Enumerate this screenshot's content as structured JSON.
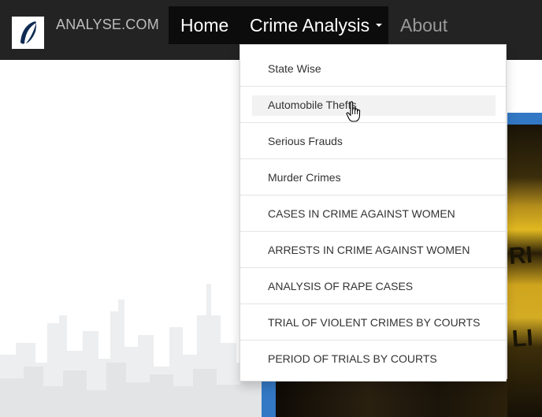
{
  "navbar": {
    "brand": "ANALYSE.COM",
    "logo_icon": "leaf-logo-icon",
    "items": [
      {
        "label": "Home"
      },
      {
        "label": "Crime Analysis"
      },
      {
        "label": "About"
      }
    ]
  },
  "dropdown": {
    "items": [
      {
        "label": "State Wise"
      },
      {
        "label": "Automobile Thefts"
      },
      {
        "label": "Serious Frauds"
      },
      {
        "label": "Murder Crimes"
      },
      {
        "label": "CASES IN CRIME AGAINST WOMEN"
      },
      {
        "label": "ARRESTS IN CRIME AGAINST WOMEN"
      },
      {
        "label": "ANALYSIS OF RAPE CASES"
      },
      {
        "label": "TRIAL OF VIOLENT CRIMES BY COURTS"
      },
      {
        "label": "PERIOD OF TRIALS BY COURTS"
      }
    ],
    "hovered_label": "Automobile Thefts"
  },
  "colors": {
    "navbar_bg": "#232323",
    "active_nav_bg": "#0c0c0c",
    "accent_blue": "#3378c4"
  }
}
